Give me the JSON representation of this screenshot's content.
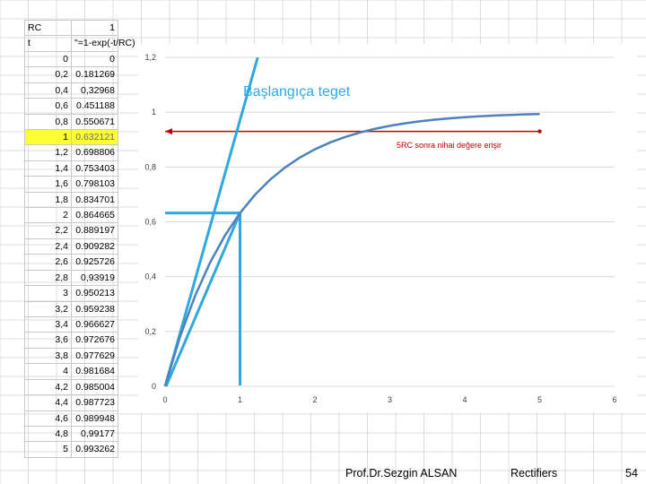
{
  "spreadsheet": {
    "rc_label": "RC",
    "rc_value": "1",
    "t_label": "t",
    "formula": "\"=1-exp(-t/RC)",
    "highlight_row": 5,
    "rows": [
      [
        "0",
        "0"
      ],
      [
        "0,2",
        "0.181269"
      ],
      [
        "0,4",
        "0,32968"
      ],
      [
        "0,6",
        "0.451188"
      ],
      [
        "0,8",
        "0.550671"
      ],
      [
        "1",
        "0.632121"
      ],
      [
        "1,2",
        "0.698806"
      ],
      [
        "1,4",
        "0.753403"
      ],
      [
        "1,6",
        "0.798103"
      ],
      [
        "1,8",
        "0.834701"
      ],
      [
        "2",
        "0.864665"
      ],
      [
        "2,2",
        "0.889197"
      ],
      [
        "2,4",
        "0.909282"
      ],
      [
        "2,6",
        "0.925726"
      ],
      [
        "2,8",
        "0,93919"
      ],
      [
        "3",
        "0.950213"
      ],
      [
        "3,2",
        "0.959238"
      ],
      [
        "3,4",
        "0.966627"
      ],
      [
        "3,6",
        "0.972676"
      ],
      [
        "3,8",
        "0.977629"
      ],
      [
        "4",
        "0.981684"
      ],
      [
        "4,2",
        "0.985004"
      ],
      [
        "4,4",
        "0.987723"
      ],
      [
        "4,6",
        "0.989948"
      ],
      [
        "4,8",
        "0,99177"
      ],
      [
        "5",
        "0.993262"
      ]
    ]
  },
  "chart_data": {
    "type": "line",
    "title": "",
    "xlabel": "",
    "ylabel": "",
    "xlim": [
      0,
      6
    ],
    "ylim": [
      0,
      1.2
    ],
    "x_ticks": [
      "0",
      "1",
      "2",
      "3",
      "4",
      "5",
      "6"
    ],
    "y_ticks": [
      "0",
      "0,2",
      "0,4",
      "0,6",
      "0,8",
      "1",
      "1,2"
    ],
    "grid": "horizontal",
    "series": [
      {
        "x": [
          0,
          0.2,
          0.4,
          0.6,
          0.8,
          1,
          1.2,
          1.4,
          1.6,
          1.8,
          2,
          2.2,
          2.4,
          2.6,
          2.8,
          3,
          3.2,
          3.4,
          3.6,
          3.8,
          4,
          4.2,
          4.4,
          4.6,
          4.8,
          5
        ],
        "values": [
          0,
          0.181269,
          0.32968,
          0.451188,
          0.550671,
          0.632121,
          0.698806,
          0.753403,
          0.798103,
          0.834701,
          0.864665,
          0.889197,
          0.909282,
          0.925726,
          0.93919,
          0.950213,
          0.959238,
          0.966627,
          0.972676,
          0.977629,
          0.981684,
          0.985004,
          0.987723,
          0.989948,
          0.99177,
          0.993262
        ]
      }
    ],
    "annotations": {
      "tangent_label": "Başlangıça teget",
      "final_value_label": "5RC sonra nihai değere erişir",
      "tangent_slope": 1,
      "tau_marker": [
        1,
        0.632121
      ],
      "final_arrow_y": 0.93,
      "final_arrow_x": [
        0,
        5
      ]
    },
    "colors": {
      "curve": "#4f81bd",
      "tangent": "#2fa8e0",
      "arrow": "#c00000",
      "grid": "#d9d9d9",
      "tick_text": "#404040"
    }
  },
  "footer": {
    "author": "Prof.Dr.Sezgin ALSAN",
    "topic": "Rectifiers",
    "page": "54"
  }
}
